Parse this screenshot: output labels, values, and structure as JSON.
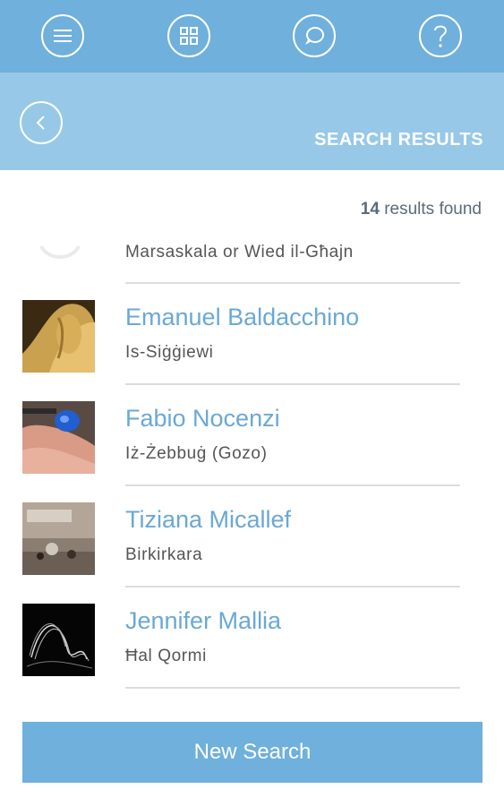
{
  "topbar": {
    "icons": [
      {
        "name": "menu-icon"
      },
      {
        "name": "grid-icon"
      },
      {
        "name": "chat-icon"
      },
      {
        "name": "help-icon"
      }
    ]
  },
  "header": {
    "title": "SEARCH RESULTS",
    "back_icon": "chevron-left-icon"
  },
  "results": {
    "count": "14",
    "count_suffix": " results found",
    "partial_item_locality": "Marsaskala or Wied il-Għajn",
    "items": [
      {
        "name": "Emanuel Baldacchino",
        "locality": "Is-Siġġiewi"
      },
      {
        "name": "Fabio Nocenzi",
        "locality": "Iż-Żebbuġ (Gozo)"
      },
      {
        "name": "Tiziana Micallef",
        "locality": "Birkirkara"
      },
      {
        "name": "Jennifer Mallia",
        "locality": "Ħal Qormi"
      }
    ]
  },
  "actions": {
    "new_search_label": "New Search"
  },
  "colors": {
    "topbar": "#6fb0dc",
    "subheader": "#97c8e8",
    "name_text": "#6aa8d6",
    "button": "#6fb0dc"
  }
}
